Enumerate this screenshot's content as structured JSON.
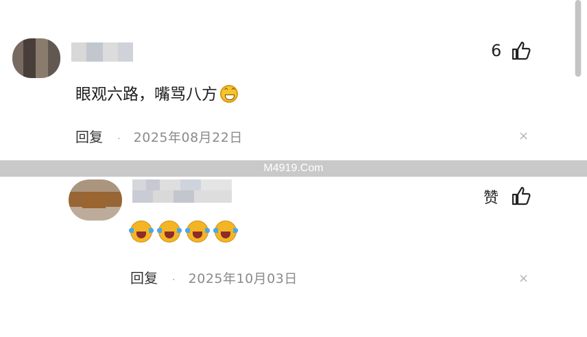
{
  "comment1": {
    "text": "眼观六路，嘴骂八方",
    "emoji": "grin-icon",
    "like_count": "6",
    "reply_label": "回复",
    "separator": "·",
    "date": "2025年08月22日",
    "close_glyph": "×"
  },
  "watermark": "M4919.Com",
  "comment2": {
    "emoji": "laugh-cry-icon",
    "emoji_count": 4,
    "like_label": "赞",
    "reply_label": "回复",
    "separator": "·",
    "date": "2025年10月03日",
    "close_glyph": "×"
  },
  "colors": {
    "emoji_yellow": "#f4b524",
    "date_gray": "#8a8a8a"
  }
}
